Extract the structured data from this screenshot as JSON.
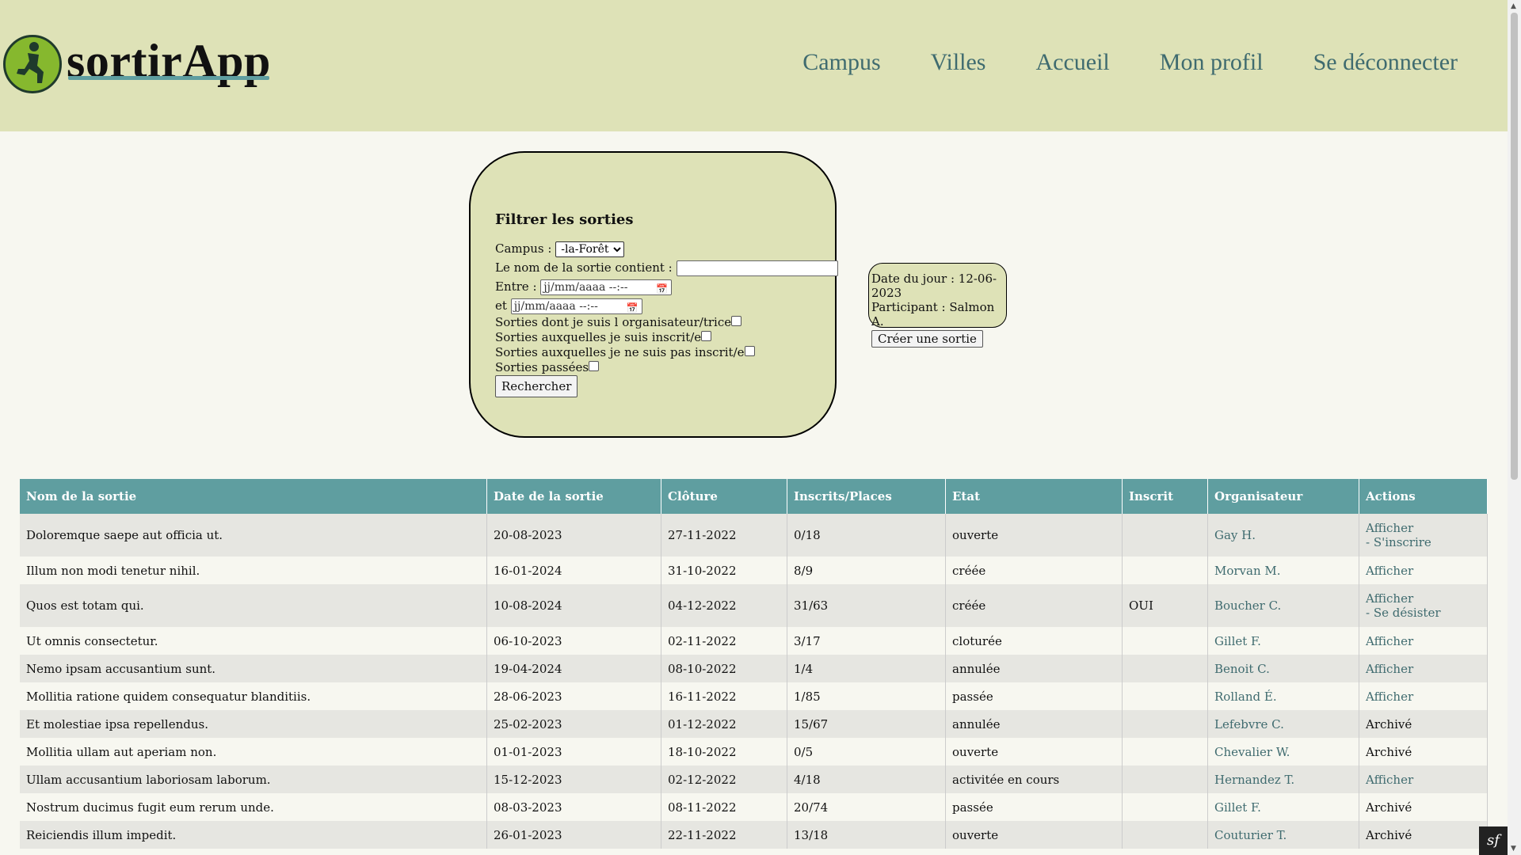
{
  "brand": {
    "name": "sortirApp",
    "logo_icon": "person-running-logo-icon"
  },
  "nav": [
    {
      "label": "Campus"
    },
    {
      "label": "Villes"
    },
    {
      "label": "Accueil"
    },
    {
      "label": "Mon profil"
    },
    {
      "label": "Se déconnecter"
    }
  ],
  "filter": {
    "title": "Filtrer les sorties",
    "campus_label": "Campus :",
    "campus_value": "-la-Forêt",
    "name_label": "Le nom de la sortie contient :",
    "name_value": "",
    "between_label": "Entre :",
    "and_label": "et",
    "date_placeholder": "jj/mm/aaaa --:--",
    "cb_organizer": "Sorties dont je suis l organisateur/trice",
    "cb_registered": "Sorties auxquelles je suis inscrit/e",
    "cb_not_registered": "Sorties auxquelles je ne suis pas inscrit/e",
    "cb_past": "Sorties passées",
    "search_button": "Rechercher"
  },
  "info": {
    "date_line": "Date du jour : 12-06-2023",
    "participant_line": "Participant : Salmon A.",
    "create_button": "Créer une sortie"
  },
  "table": {
    "headers": [
      "Nom de la sortie",
      "Date de la sortie",
      "Clôture",
      "Inscrits/Places",
      "Etat",
      "Inscrit",
      "Organisateur",
      "Actions"
    ],
    "rows": [
      {
        "name": "Doloremque saepe aut officia ut.",
        "date": "20-08-2023",
        "close": "27-11-2022",
        "places": "0/18",
        "state": "ouverte",
        "registered": "",
        "organizer": "Gay H.",
        "action1": "Afficher",
        "action2": "- S'inscrire"
      },
      {
        "name": "Illum non modi tenetur nihil.",
        "date": "16-01-2024",
        "close": "31-10-2022",
        "places": "8/9",
        "state": "créée",
        "registered": "",
        "organizer": "Morvan M.",
        "action1": "Afficher",
        "action2": ""
      },
      {
        "name": "Quos est totam qui.",
        "date": "10-08-2024",
        "close": "04-12-2022",
        "places": "31/63",
        "state": "créée",
        "registered": "OUI",
        "organizer": "Boucher C.",
        "action1": "Afficher",
        "action2": "- Se désister"
      },
      {
        "name": "Ut omnis consectetur.",
        "date": "06-10-2023",
        "close": "02-11-2022",
        "places": "3/17",
        "state": "cloturée",
        "registered": "",
        "organizer": "Gillet F.",
        "action1": "Afficher",
        "action2": ""
      },
      {
        "name": "Nemo ipsam accusantium sunt.",
        "date": "19-04-2024",
        "close": "08-10-2022",
        "places": "1/4",
        "state": "annulée",
        "registered": "",
        "organizer": "Benoit C.",
        "action1": "Afficher",
        "action2": ""
      },
      {
        "name": "Mollitia ratione quidem consequatur blanditiis.",
        "date": "28-06-2023",
        "close": "16-11-2022",
        "places": "1/85",
        "state": "passée",
        "registered": "",
        "organizer": "Rolland É.",
        "action1": "Afficher",
        "action2": ""
      },
      {
        "name": "Et molestiae ipsa repellendus.",
        "date": "25-02-2023",
        "close": "01-12-2022",
        "places": "15/67",
        "state": "annulée",
        "registered": "",
        "organizer": "Lefebvre C.",
        "action1": "Archivé",
        "action2": ""
      },
      {
        "name": "Mollitia ullam aut aperiam non.",
        "date": "01-01-2023",
        "close": "18-10-2022",
        "places": "0/5",
        "state": "ouverte",
        "registered": "",
        "organizer": "Chevalier W.",
        "action1": "Archivé",
        "action2": ""
      },
      {
        "name": "Ullam accusantium laboriosam laborum.",
        "date": "15-12-2023",
        "close": "02-12-2022",
        "places": "4/18",
        "state": "activitée en cours",
        "registered": "",
        "organizer": "Hernandez T.",
        "action1": "Afficher",
        "action2": ""
      },
      {
        "name": "Nostrum ducimus fugit eum rerum unde.",
        "date": "08-03-2023",
        "close": "08-11-2022",
        "places": "20/74",
        "state": "passée",
        "registered": "",
        "organizer": "Gillet F.",
        "action1": "Archivé",
        "action2": ""
      },
      {
        "name": "Reiciendis illum impedit.",
        "date": "26-01-2023",
        "close": "22-11-2022",
        "places": "13/18",
        "state": "ouverte",
        "registered": "",
        "organizer": "Couturier T.",
        "action1": "Archivé",
        "action2": ""
      }
    ]
  },
  "colors": {
    "header_bg": "#dee2b7",
    "table_header_bg": "#5f9ea0",
    "link": "#3f6b6f"
  }
}
